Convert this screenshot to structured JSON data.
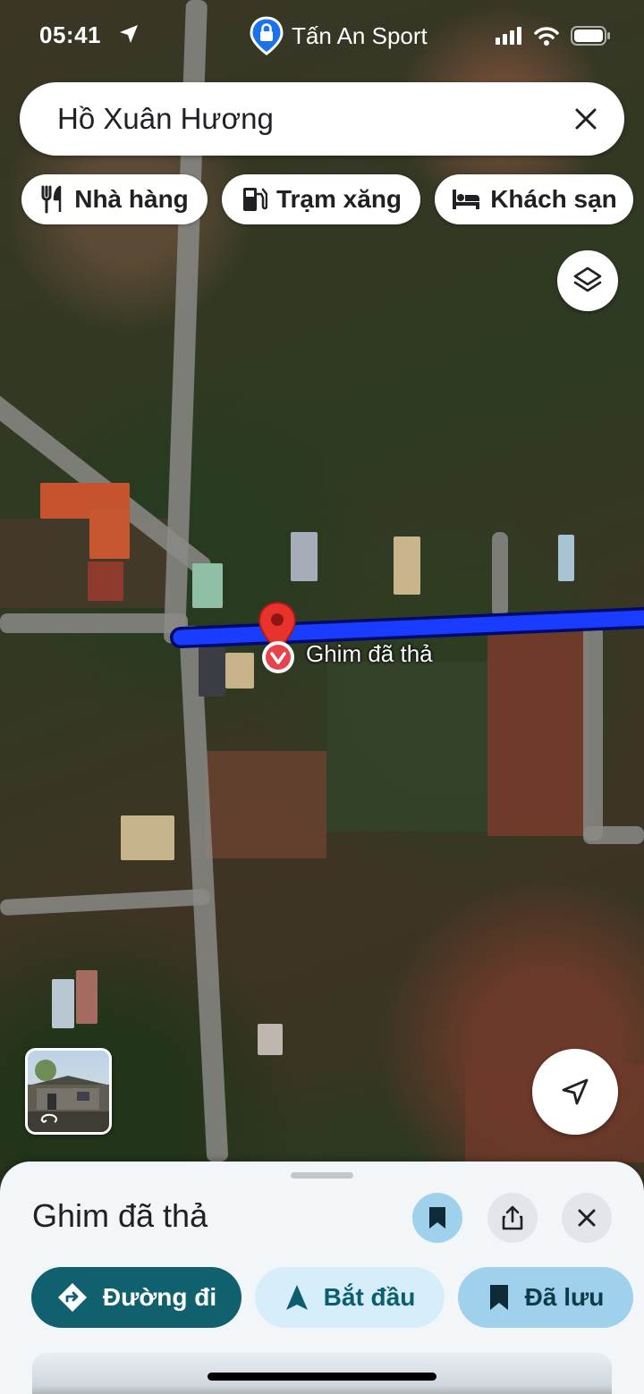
{
  "status_bar": {
    "time": "05:41",
    "hotspot_name": "Tấn An Sport"
  },
  "search": {
    "query": "Hồ Xuân Hương"
  },
  "chips": [
    {
      "label": "Nhà hàng",
      "icon": "restaurant-icon"
    },
    {
      "label": "Trạm xăng",
      "icon": "gas-station-icon"
    },
    {
      "label": "Khách sạn",
      "icon": "hotel-icon"
    }
  ],
  "map": {
    "type": "satellite",
    "pin_label": "Ghim đã thả",
    "route_color": "#1a3cff",
    "pin_color": "#e8322c"
  },
  "sheet": {
    "title": "Ghim đã thả",
    "buttons": {
      "directions": "Đường đi",
      "start": "Bắt đầu",
      "saved": "Đã lưu"
    }
  },
  "colors": {
    "primary_button": "#10606d",
    "secondary_button": "#d6eef9",
    "saved_button": "#9fd1ec",
    "sheet_background": "#f3f6f9"
  }
}
